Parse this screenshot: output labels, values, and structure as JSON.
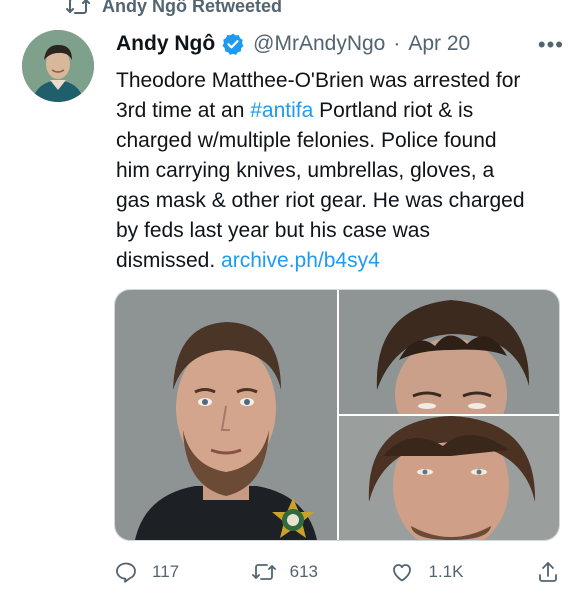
{
  "retweet_bar": {
    "text": "Andy Ngô Retweeted",
    "icon": "retweet-icon"
  },
  "tweet": {
    "author_name": "Andy Ngô",
    "handle": "@MrAndyNgo",
    "separator": "·",
    "date": "Apr 20",
    "more_label": "•••",
    "verified_icon": "verified-badge-icon",
    "text_lines": [
      {
        "before": "Theodore Matthee-O'Brien was arrested for"
      },
      {
        "before": "3rd time at an ",
        "tag": "#antifa",
        "after": " Portland riot & is"
      },
      {
        "before": "charged w/multiple felonies. Police found"
      },
      {
        "before": "him carrying knives, umbrellas, gloves, a"
      },
      {
        "before": "gas mask & other riot gear. He was charged"
      },
      {
        "before": "by feds last year but his case was"
      },
      {
        "before": "dismissed. ",
        "link": "archive.ph/b4sy4"
      }
    ],
    "media": [
      {
        "name": "mugshot-front",
        "icon": "mugshot-photo"
      },
      {
        "name": "mugshot-top-right",
        "icon": "mugshot-photo"
      },
      {
        "name": "mugshot-bottom-right",
        "icon": "mugshot-photo"
      }
    ]
  },
  "actions": {
    "reply_count": "117",
    "retweet_count": "613",
    "like_count": "1.1K"
  },
  "colors": {
    "accent": "#1d9bf0",
    "secondary_text": "#536471",
    "primary_text": "#0f1419",
    "border": "#cfd9de"
  }
}
